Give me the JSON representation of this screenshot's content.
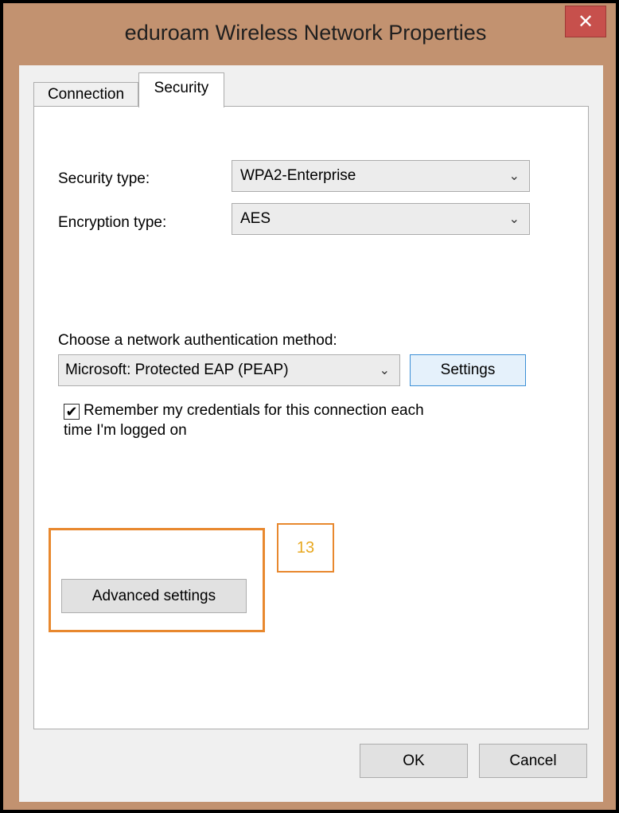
{
  "window": {
    "title": "eduroam Wireless Network Properties",
    "close_label": "✕"
  },
  "tabs": [
    {
      "label": "Connection"
    },
    {
      "label": "Security"
    }
  ],
  "security": {
    "security_type_label": "Security type:",
    "security_type_value": "WPA2-Enterprise",
    "encryption_type_label": "Encryption type:",
    "encryption_type_value": "AES",
    "auth_method_label": "Choose a network authentication method:",
    "auth_method_value": "Microsoft: Protected EAP (PEAP)",
    "settings_label": "Settings",
    "remember_label_line1": "Remember my credentials for this connection each",
    "remember_label_line2": "time I'm logged on",
    "remember_checked": true,
    "remember_check_glyph": "✔",
    "advanced_label": "Advanced settings"
  },
  "annotation": {
    "number": "13",
    "color": "#e8882e"
  },
  "footer": {
    "ok_label": "OK",
    "cancel_label": "Cancel"
  },
  "chevron_glyph": "⌄"
}
